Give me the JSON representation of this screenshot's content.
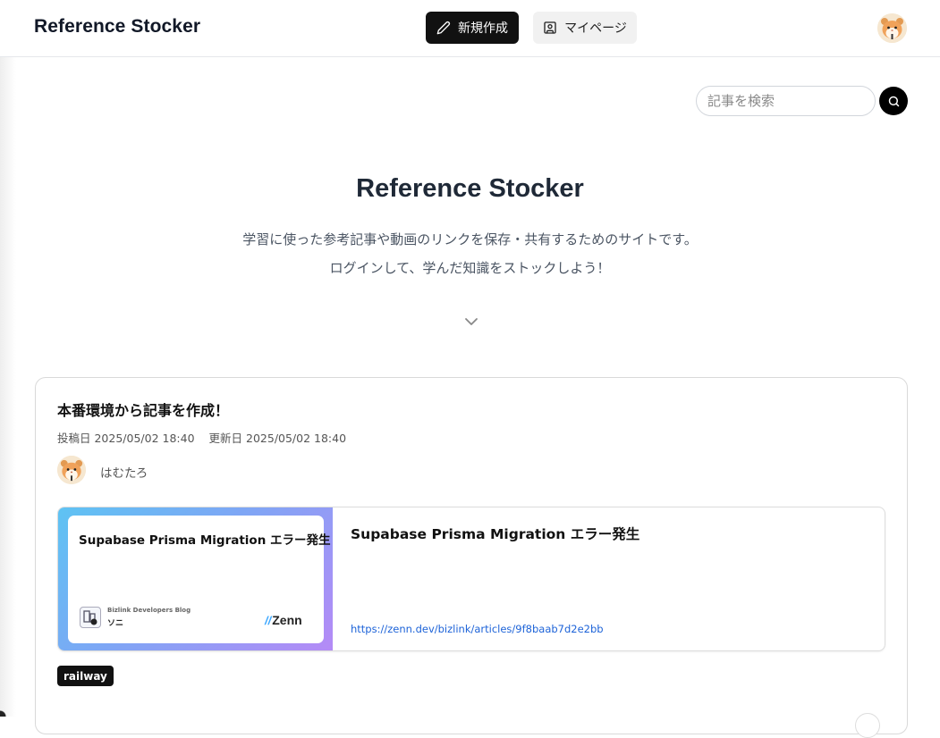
{
  "header": {
    "brand": "Reference Stocker",
    "new_button_label": "新規作成",
    "mypage_button_label": "マイページ"
  },
  "search": {
    "placeholder": "記事を検索"
  },
  "hero": {
    "title": "Reference Stocker",
    "subtitle_line1": "学習に使った参考記事や動画のリンクを保存・共有するためのサイトです。",
    "subtitle_line2": "ログインして、学んだ知識をストックしよう！"
  },
  "post": {
    "title": "本番環境から記事を作成！",
    "posted_label": "投稿日 2025/05/02 18:40",
    "updated_label": "更新日 2025/05/02 18:40",
    "author": "はむたろ",
    "link": {
      "ogp_title": "Supabase Prisma Migration エラー発生",
      "ogp_blog": "Bizlink Developers Blog",
      "ogp_author": "ソニ",
      "ogp_brand": "Zenn",
      "title": "Supabase Prisma Migration エラー発生",
      "url": "https://zenn.dev/bizlink/articles/9f8baab7d2e2bb"
    },
    "tags": [
      "railway"
    ]
  },
  "icons": {
    "new": "pencil-icon",
    "mypage": "user-square-icon",
    "search": "search-icon",
    "scroll": "chevron-down-icon",
    "avatar": "hamster-avatar"
  },
  "colors": {
    "primary": "#111111",
    "link": "#1d63d8",
    "ogp_gradient_start": "#5ec3f3",
    "ogp_gradient_end": "#b58af6"
  }
}
